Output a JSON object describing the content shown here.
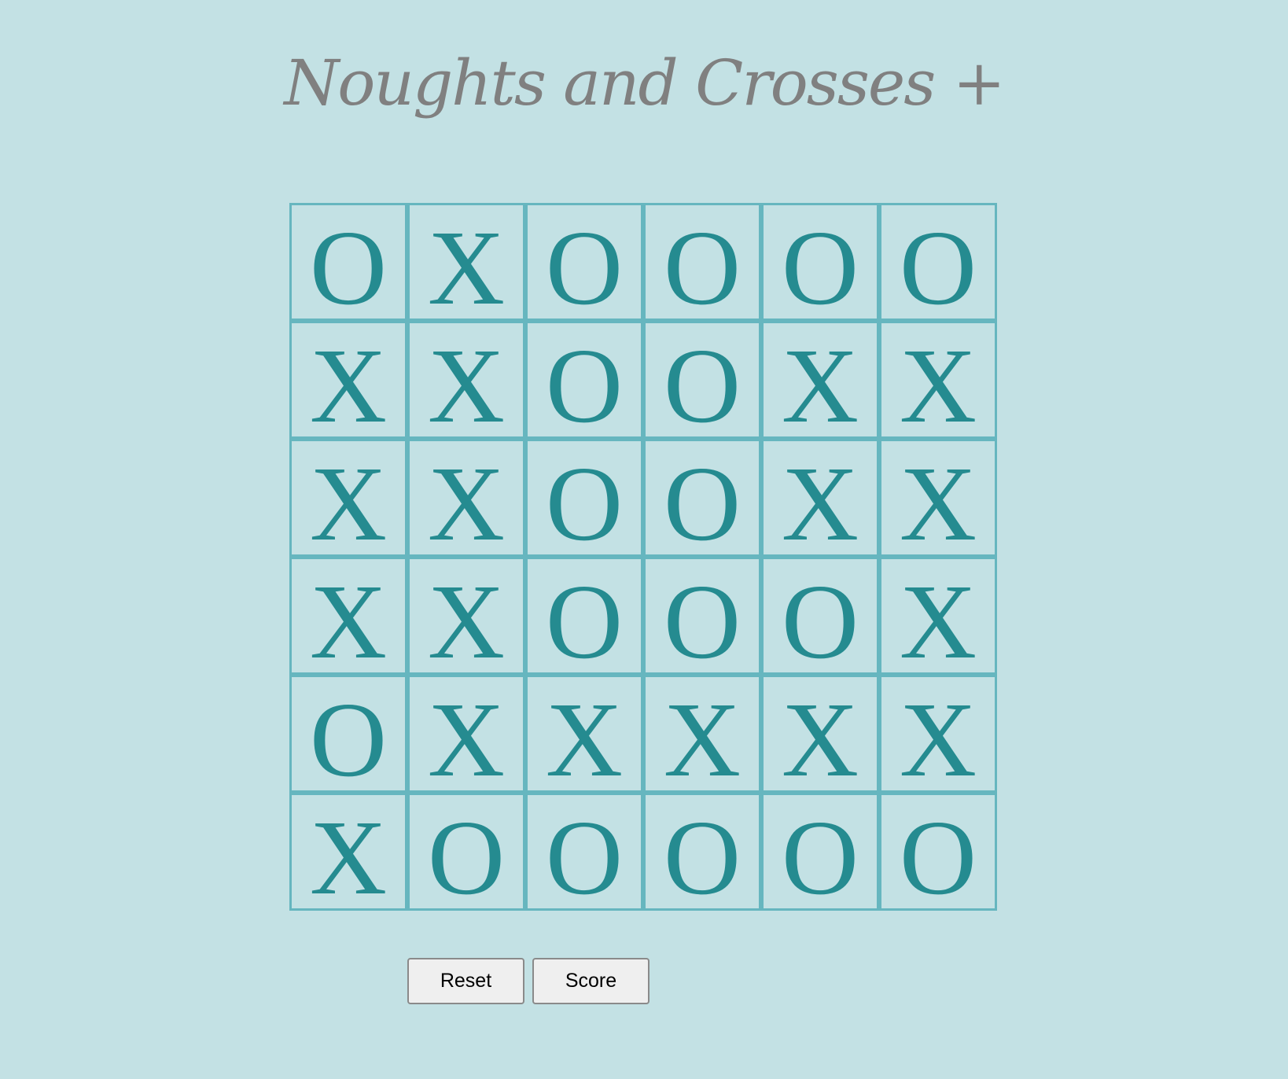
{
  "title": "Noughts and Crosses +",
  "colors": {
    "background": "#c3e1e4",
    "grid_line": "#66b6bf",
    "mark": "#258b90",
    "title": "#808080"
  },
  "board": [
    [
      "O",
      "X",
      "O",
      "O",
      "O",
      "O"
    ],
    [
      "X",
      "X",
      "O",
      "O",
      "X",
      "X"
    ],
    [
      "X",
      "X",
      "O",
      "O",
      "X",
      "X"
    ],
    [
      "X",
      "X",
      "O",
      "O",
      "O",
      "X"
    ],
    [
      "O",
      "X",
      "X",
      "X",
      "X",
      "X"
    ],
    [
      "X",
      "O",
      "O",
      "O",
      "O",
      "O"
    ]
  ],
  "buttons": {
    "reset_label": "Reset",
    "score_label": "Score"
  }
}
